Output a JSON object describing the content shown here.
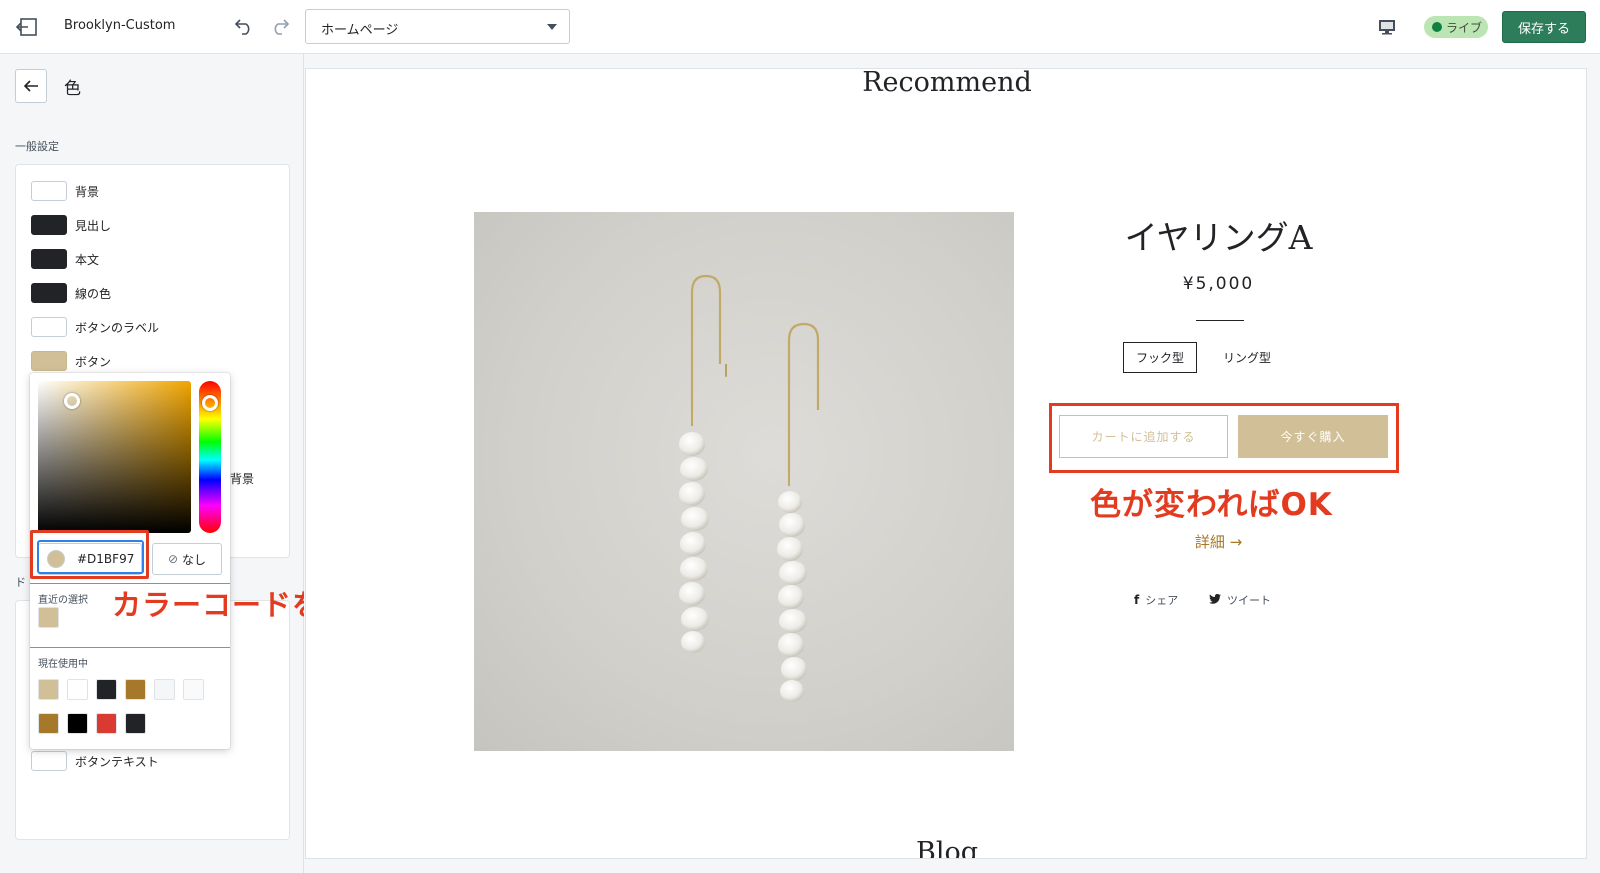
{
  "topbar": {
    "theme_name": "Brooklyn-Custom",
    "page_select_value": "ホームページ",
    "live_label": "ライブ",
    "save_label": "保存する"
  },
  "sidebar": {
    "title": "色",
    "section_general": "一般設定",
    "section_doc_partial": "ド",
    "rows": [
      {
        "label": "背景",
        "color": "#ffffff"
      },
      {
        "label": "見出し",
        "color": "#212326"
      },
      {
        "label": "本文",
        "color": "#212326"
      },
      {
        "label": "線の色",
        "color": "#212326"
      },
      {
        "label": "ボタンのラベル",
        "color": "#ffffff"
      },
      {
        "label": "ボタン",
        "color": "#d1bf97"
      }
    ],
    "partial_label": "背景",
    "bottom_row": {
      "label": "ボタンテキスト",
      "color": "#ffffff"
    }
  },
  "picker": {
    "hex_value": "#D1BF97",
    "none_label": "なし",
    "recent_label": "直近の選択",
    "recent_colors": [
      "#d1bf97"
    ],
    "in_use_label": "現在使用中",
    "in_use_colors": [
      "#d1bf97",
      "#ffffff",
      "#212326",
      "#a6782a",
      "#f4f6f8",
      "#f9fafb",
      "#a6782a",
      "#000000",
      "#d93a32",
      "#212326"
    ]
  },
  "annotations": {
    "hex_note": "カラーコードを入力",
    "buttons_note": "色が変わればOK"
  },
  "preview": {
    "section_title": "Recommend",
    "product_name": "イヤリングA",
    "price": "¥5,000",
    "variants": [
      "フック型",
      "リング型"
    ],
    "add_to_cart": "カートに追加する",
    "buy_now": "今すぐ購入",
    "details_link": "詳細 →",
    "share_facebook": "シェア",
    "share_twitter": "ツイート",
    "next_section_title": "Blog"
  },
  "colors": {
    "accent_green": "#2e7d5a",
    "button_color": "#d1bf97",
    "annotation_red": "#e33b20"
  }
}
